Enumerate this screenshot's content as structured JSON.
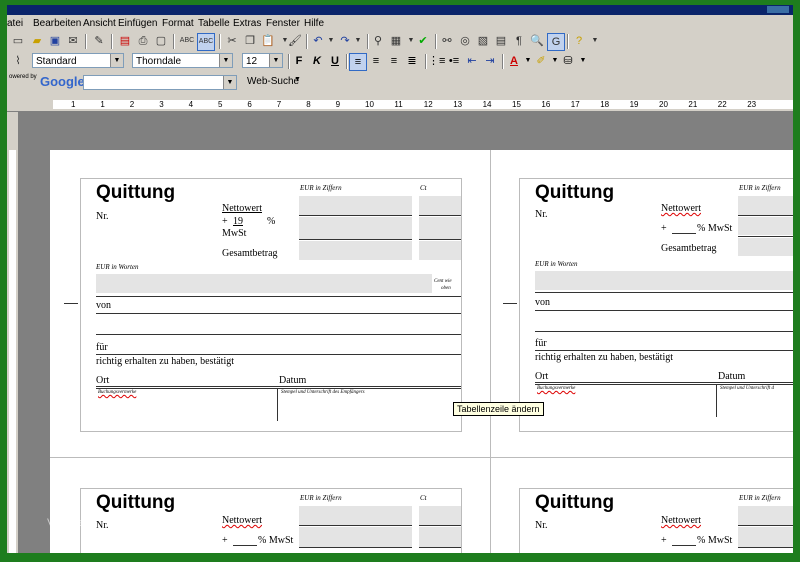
{
  "menu": [
    "atei",
    "Bearbeiten",
    "Ansicht",
    "Einfügen",
    "Format",
    "Tabelle",
    "Extras",
    "Fenster",
    "Hilfe"
  ],
  "format_bar": {
    "style": "Standard",
    "font": "Thorndale",
    "size": "12",
    "bold": "F",
    "italic": "K",
    "underline": "U"
  },
  "google_bar": {
    "powered_by": "owered by",
    "logo": "Google",
    "search_button": "Web-Suche"
  },
  "ruler_numbers": [
    "1",
    "1",
    "2",
    "3",
    "4",
    "5",
    "6",
    "7",
    "8",
    "9",
    "10",
    "11",
    "12",
    "13",
    "14",
    "15",
    "16",
    "17",
    "18",
    "19",
    "20",
    "21",
    "22",
    "23"
  ],
  "receipt": {
    "title": "Quittung",
    "nr": "Nr.",
    "eur_ziffern": "EUR in Ziffern",
    "ct": "Ct",
    "nettowert": "Nettowert",
    "mwst_prefix": "+",
    "mwst_rate": "19",
    "mwst_suffix": "%",
    "mwst_label": "MwSt",
    "mwst_inline": "% MwSt",
    "gesamtbetrag": "Gesamtbetrag",
    "eur_worten": "EUR in Worten",
    "cent_note_1": "Cent wie",
    "cent_note_2": "oben",
    "von": "von",
    "fuer": "für",
    "bestaetigt": "richtig erhalten zu haben, bestätigt",
    "ort": "Ort",
    "datum": "Datum",
    "buchung": "Buchungsvermerke",
    "stempel": "Stempel und Unterschrift des Empfängers",
    "stempel_short": "Stempel und Unterschrift d"
  },
  "tooltip": "Tabellenzeile ändern",
  "watermark": "Vorlage"
}
